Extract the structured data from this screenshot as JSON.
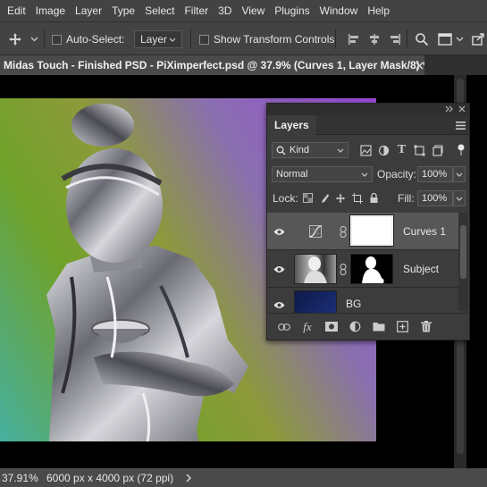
{
  "menubar": {
    "items": [
      "Edit",
      "Image",
      "Layer",
      "Type",
      "Select",
      "Filter",
      "3D",
      "View",
      "Plugins",
      "Window",
      "Help"
    ]
  },
  "options": {
    "move_tool_icon": "move-arrows-icon",
    "auto_select_label": "Auto-Select:",
    "auto_select_target": "Layer",
    "show_transform_label": "Show Transform Controls"
  },
  "document": {
    "tab_title": "Midas Touch - Finished PSD - PiXimperfect.psd @ 37.9% (Curves 1, Layer Mask/8) *"
  },
  "status": {
    "zoom": "37.91%",
    "doc_info": "6000 px x 4000 px (72 ppi)"
  },
  "layers_panel": {
    "title": "Layers",
    "filter_kind": "Kind",
    "blend_mode": "Normal",
    "opacity_label": "Opacity:",
    "opacity_value": "100%",
    "lock_label": "Lock:",
    "fill_label": "Fill:",
    "fill_value": "100%",
    "layers": [
      {
        "name": "Curves 1",
        "selected": true
      },
      {
        "name": "Subject",
        "selected": false
      },
      {
        "name": "BG",
        "selected": false
      }
    ],
    "colors": {
      "panel_bg": "#3c3c3c",
      "selected_row": "#575757"
    }
  }
}
